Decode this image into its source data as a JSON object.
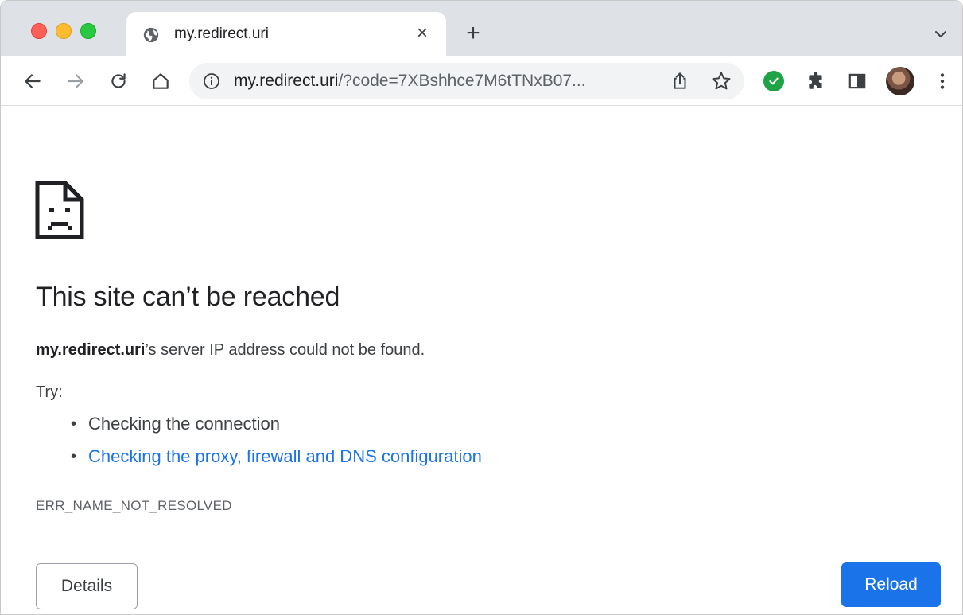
{
  "tab": {
    "title": "my.redirect.uri",
    "favicon": "globe-icon",
    "close": "×",
    "new_tab": "+"
  },
  "toolbar": {
    "url_host": "my.redirect.uri",
    "url_rest": "/?code=7XBshhce7M6tTNxB07...",
    "icons": [
      "back-arrow-icon",
      "forward-arrow-icon",
      "reload-icon",
      "home-icon",
      "info-icon",
      "share-icon",
      "star-icon",
      "extension-check-icon",
      "puzzle-icon",
      "side-panel-icon",
      "avatar",
      "more-menu-icon"
    ]
  },
  "error_page": {
    "heading": "This site can’t be reached",
    "message_host": "my.redirect.uri",
    "message_rest": "’s server IP address could not be found.",
    "try_label": "Try:",
    "suggestions": [
      "Checking the connection",
      "Checking the proxy, firewall and DNS configuration"
    ],
    "error_code": "ERR_NAME_NOT_RESOLVED",
    "details_button": "Details",
    "reload_button": "Reload"
  },
  "colors": {
    "tabstrip": "#dee1e6",
    "link": "#1a73e8",
    "reload_button": "#1a73e8",
    "extension_check": "#1ea446"
  }
}
